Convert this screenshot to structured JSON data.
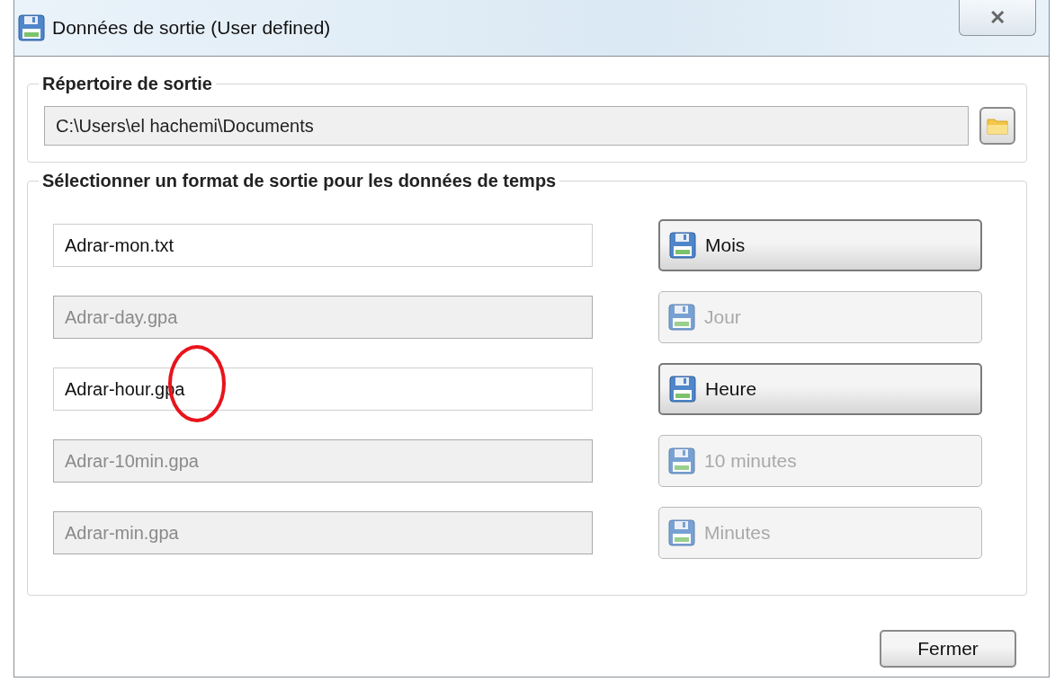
{
  "window": {
    "title": "Données de sortie (User defined)",
    "close_label": "✕"
  },
  "output_dir": {
    "legend": "Répertoire de sortie",
    "value": "C:\\Users\\el hachemi\\Documents"
  },
  "formats": {
    "legend": "Sélectionner un format de sortie pour les données de temps",
    "rows": [
      {
        "file": "Adrar-mon.txt",
        "button": "Mois",
        "disabled": false,
        "annotated": false
      },
      {
        "file": "Adrar-day.gpa",
        "button": "Jour",
        "disabled": true,
        "annotated": false
      },
      {
        "file": "Adrar-hour.gpa",
        "button": "Heure",
        "disabled": false,
        "annotated": true
      },
      {
        "file": "Adrar-10min.gpa",
        "button": "10 minutes",
        "disabled": true,
        "annotated": false
      },
      {
        "file": "Adrar-min.gpa",
        "button": "Minutes",
        "disabled": true,
        "annotated": false
      }
    ]
  },
  "close_button": "Fermer"
}
